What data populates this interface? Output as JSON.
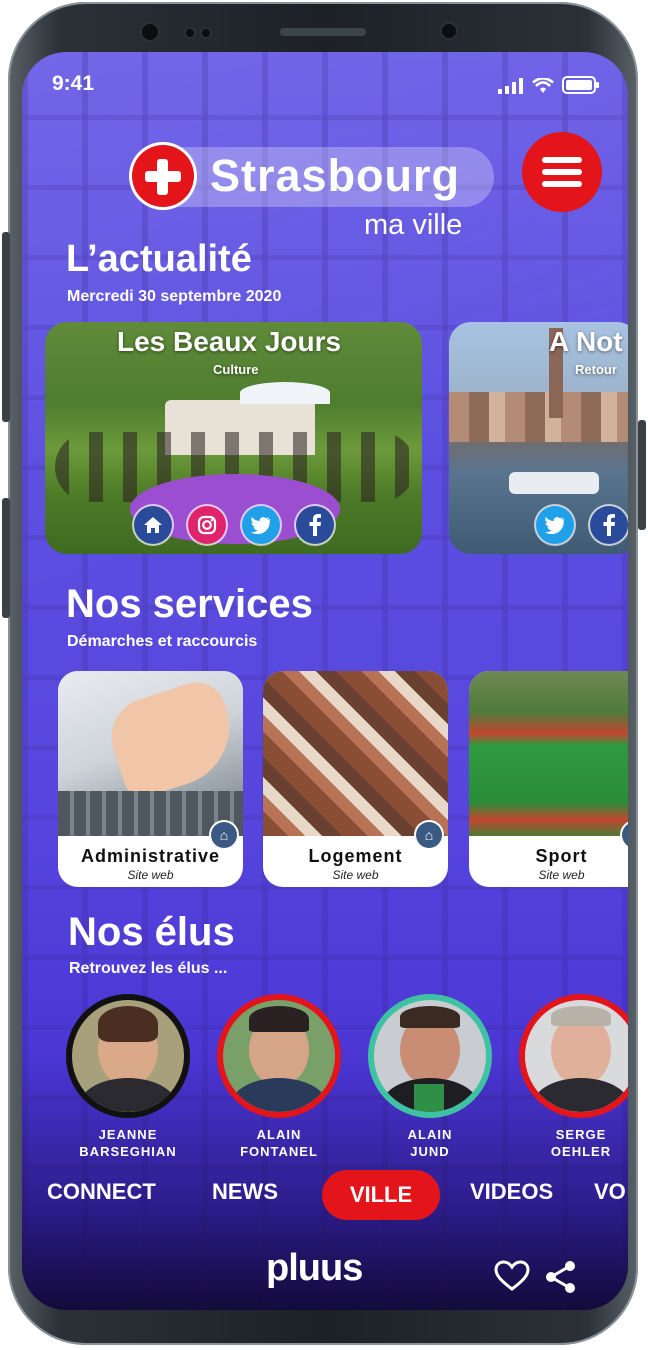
{
  "status": {
    "time": "9:41"
  },
  "header": {
    "city": "Strasbourg",
    "tagline": "ma ville"
  },
  "news": {
    "title": "L’actualité",
    "date": "Mercredi 30 septembre 2020",
    "cards": [
      {
        "title": "Les Beaux Jours",
        "category": "Culture"
      },
      {
        "title": "A Not",
        "category": "Retour"
      }
    ]
  },
  "services": {
    "title": "Nos services",
    "subtitle": "Démarches et raccourcis",
    "items": [
      {
        "label": "Administrative",
        "sub": "Site web"
      },
      {
        "label": "Logement",
        "sub": "Site web"
      },
      {
        "label": "Sport",
        "sub": "Site web"
      }
    ]
  },
  "elus": {
    "title": "Nos élus",
    "subtitle": "Retrouvez les élus ...",
    "people": [
      {
        "first": "JEANNE",
        "last": "BARSEGHIAN",
        "ring": "#111111"
      },
      {
        "first": "ALAIN",
        "last": "FONTANEL",
        "ring": "#e3141a"
      },
      {
        "first": "ALAIN",
        "last": "JUND",
        "ring": "#3fc2a4"
      },
      {
        "first": "SERGE",
        "last": "OEHLER",
        "ring": "#e3141a"
      }
    ]
  },
  "tabs": {
    "items": [
      "CONNECT",
      "NEWS",
      "VILLE",
      "VIDEOS",
      "VO"
    ],
    "active": "VILLE"
  },
  "footer": {
    "brand": "pluus"
  },
  "colors": {
    "accent": "#e3141a",
    "background": "#5b4ee0"
  },
  "icons": [
    "signal-icon",
    "wifi-icon",
    "battery-icon",
    "swiss-cross-icon",
    "hamburger-menu-icon",
    "home-icon",
    "instagram-icon",
    "twitter-icon",
    "facebook-icon",
    "heart-icon",
    "share-icon"
  ]
}
